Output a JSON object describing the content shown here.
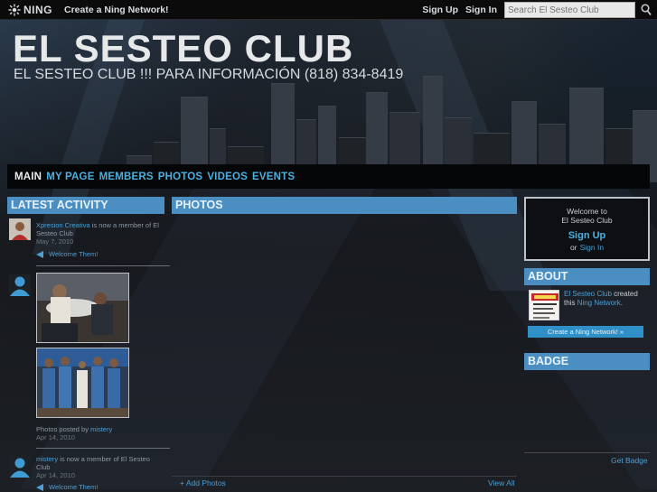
{
  "ningbar": {
    "logo_text": "NING",
    "create_link": "Create a Ning Network!",
    "sign_up": "Sign Up",
    "sign_in": "Sign In",
    "search_placeholder": "Search El Sesteo Club"
  },
  "header": {
    "title": "EL SESTEO CLUB",
    "subtitle": "EL SESTEO CLUB !!! PARA INFORMACIÓN (818) 834-8419"
  },
  "nav": {
    "items": [
      {
        "label": "MAIN",
        "active": true
      },
      {
        "label": "MY PAGE",
        "active": false
      },
      {
        "label": "MEMBERS",
        "active": false
      },
      {
        "label": "PHOTOS",
        "active": false
      },
      {
        "label": "VIDEOS",
        "active": false
      },
      {
        "label": "EVENTS",
        "active": false
      }
    ]
  },
  "latest_activity": {
    "heading": "LATEST ACTIVITY",
    "items": [
      {
        "user": "Xpresion Creativa",
        "text": " is now a member of El Sesteo Club",
        "date": "May 7, 2010",
        "welcome": "Welcome Them!"
      },
      {
        "caption_prefix": "Photos posted by ",
        "user": "mistery",
        "date": "Apr 14, 2010"
      },
      {
        "user": "mistery",
        "text": " is now a member of El Sesteo Club",
        "date": "Apr 14, 2010",
        "welcome": "Welcome Them!"
      }
    ]
  },
  "photos": {
    "heading": "PHOTOS",
    "add_link": "+ Add Photos",
    "view_all": "View All"
  },
  "welcome_box": {
    "line1": "Welcome to",
    "line2": "El Sesteo Club",
    "sign_up": "Sign Up",
    "or": "or",
    "sign_in": "Sign In"
  },
  "about": {
    "heading": "ABOUT",
    "creator": "El Sesteo Club",
    "created_text": " created this ",
    "network_link": "Ning Network",
    "period": ".",
    "create_button": "Create a Ning Network! »"
  },
  "badge": {
    "heading": "BADGE",
    "get_badge": "Get Badge"
  },
  "colors": {
    "accent": "#4b8fc2",
    "link": "#4d9fd4",
    "nav_bg": "#050607"
  }
}
